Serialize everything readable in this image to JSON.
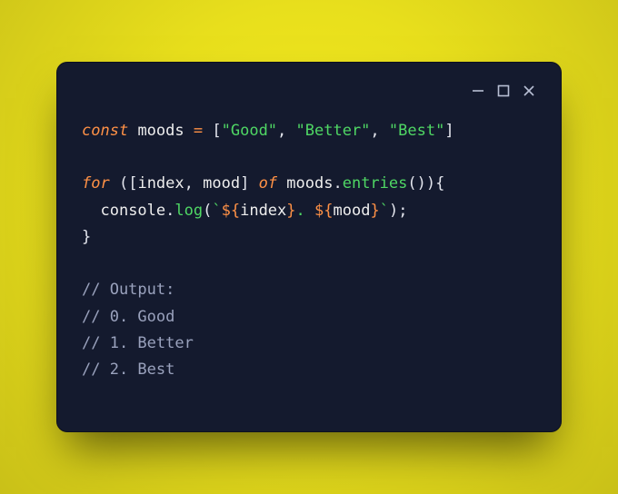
{
  "code": {
    "l1_const": "const",
    "l1_name": "moods",
    "l1_eq": "=",
    "l1_ob": "[",
    "l1_s1": "\"Good\"",
    "l1_c1": ", ",
    "l1_s2": "\"Better\"",
    "l1_c2": ", ",
    "l1_s3": "\"Best\"",
    "l1_cb": "]",
    "l3_for": "for",
    "l3_open": " (",
    "l3_ob": "[",
    "l3_index": "index",
    "l3_c1": ", ",
    "l3_mood": "mood",
    "l3_cb": "]",
    "l3_of": " of ",
    "l3_moods": "moods",
    "l3_dot": ".",
    "l3_entries": "entries",
    "l3_call": "()",
    "l3_close": ")",
    "l3_brace": "{",
    "l4_indent": "  ",
    "l4_console": "console",
    "l4_dot": ".",
    "l4_log": "log",
    "l4_open": "(",
    "l4_bt1": "`",
    "l4_i1o": "${",
    "l4_i1v": "index",
    "l4_i1c": "}",
    "l4_mid": ". ",
    "l4_i2o": "${",
    "l4_i2v": "mood",
    "l4_i2c": "}",
    "l4_bt2": "`",
    "l4_close": ");",
    "l5_brace": "}",
    "c1": "// Output:",
    "c2": "// 0. Good",
    "c3": "// 1. Better",
    "c4": "// 2. Best"
  }
}
